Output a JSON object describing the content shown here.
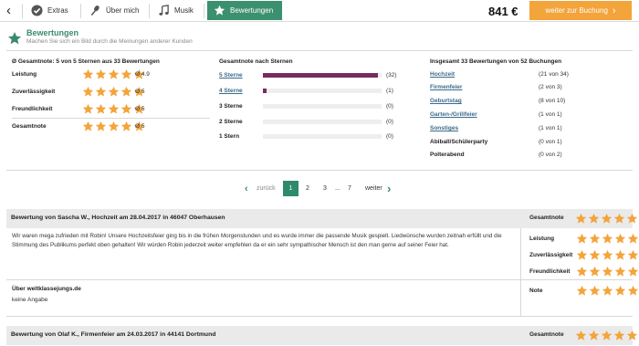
{
  "nav": {
    "back_glyph": "‹",
    "tabs": [
      {
        "label": "Extras",
        "icon": "check-circle-icon"
      },
      {
        "label": "Über mich",
        "icon": "microphone-icon"
      },
      {
        "label": "Musik",
        "icon": "music-note-icon"
      },
      {
        "label": "Bewertungen",
        "icon": "star-icon",
        "active": true
      }
    ],
    "price": "841 €",
    "book_label": "weiter zur Buchung",
    "book_arrow": "›"
  },
  "header": {
    "title": "Bewertungen",
    "subtitle": "Machen Sie sich ein Bild durch die Meinungen anderer Kunden"
  },
  "summary": {
    "heading": "Ø Gesamtnote: 5 von 5 Sternen aus 33 Bewertungen",
    "rows": [
      {
        "label": "Leistung",
        "stars": 5,
        "value": "Ø 4.9"
      },
      {
        "label": "Zuverlässigkeit",
        "stars": 5,
        "value": "Ø 5"
      },
      {
        "label": "Freundlichkeit",
        "stars": 5,
        "value": "Ø 5"
      },
      {
        "label": "Gesamtnote",
        "stars": 5,
        "value": "Ø 5"
      }
    ]
  },
  "distribution": {
    "heading": "Gesamtnote nach Sternen",
    "rows": [
      {
        "label": "5 Sterne",
        "linked": true,
        "count": "(32)",
        "fraction": 0.97
      },
      {
        "label": "4 Sterne",
        "linked": true,
        "count": "(1)",
        "fraction": 0.03
      },
      {
        "label": "3 Sterne",
        "linked": false,
        "count": "(0)",
        "fraction": 0
      },
      {
        "label": "2 Sterne",
        "linked": false,
        "count": "(0)",
        "fraction": 0
      },
      {
        "label": "1 Stern",
        "linked": false,
        "count": "(0)",
        "fraction": 0
      }
    ]
  },
  "events": {
    "heading": "Insgesamt 33 Bewertungen von 52 Buchungen",
    "rows": [
      {
        "label": "Hochzeit",
        "linked": true,
        "value": "(21 von 34)"
      },
      {
        "label": "Firmenfeier",
        "linked": true,
        "value": "(2 von 3)"
      },
      {
        "label": "Geburtstag",
        "linked": true,
        "value": "(8 von 10)"
      },
      {
        "label": "Garten-/Grillfeier",
        "linked": true,
        "value": "(1 von 1)"
      },
      {
        "label": "Sonstiges",
        "linked": true,
        "value": "(1 von 1)"
      },
      {
        "label": "Abiball/Schülerparty",
        "linked": false,
        "value": "(0 von 1)"
      },
      {
        "label": "Polterabend",
        "linked": false,
        "value": "(0 von 2)"
      }
    ]
  },
  "pagination": {
    "prev": "zurück",
    "pages": [
      "1",
      "2",
      "3",
      "...",
      "7"
    ],
    "current": "1",
    "next": "weiter"
  },
  "reviews": [
    {
      "title": "Bewertung von Sascha W., Hochzeit am 28.04.2017 in 46047 Oberhausen",
      "overall_label": "Gesamtnote",
      "overall_stars": 5,
      "text": "Wir waren mega zufrieden mit Robin! Unsere Hochzeitsfeier ging bis in die frühen Morgenstunden und es wurde immer die passende Musik gespielt. Liedwünsche wurden zeitnah erfüllt und die Stimmung des Publikums perfekt oben gehalten! Wir würden Robin jederzeit weiter empfehlen da er ein sehr sympathischer Mensch ist den man gerne auf seiner Feier hat.",
      "ratings": [
        {
          "label": "Leistung",
          "stars": 5
        },
        {
          "label": "Zuverlässigkeit",
          "stars": 5
        },
        {
          "label": "Freundlichkeit",
          "stars": 5
        }
      ],
      "source_label": "Über weltklassejungs.de",
      "source_value": "keine Angabe",
      "note_label": "Note",
      "note_stars": 5
    },
    {
      "title": "Bewertung von Olaf K., Firmenfeier am 24.03.2017 in 44141 Dortmund",
      "overall_label": "Gesamtnote",
      "overall_stars": 5
    }
  ],
  "colors": {
    "green": "#3b9070",
    "orange": "#f3a43b",
    "star": "#f3a43b",
    "bar_fill": "#7a2a62"
  }
}
